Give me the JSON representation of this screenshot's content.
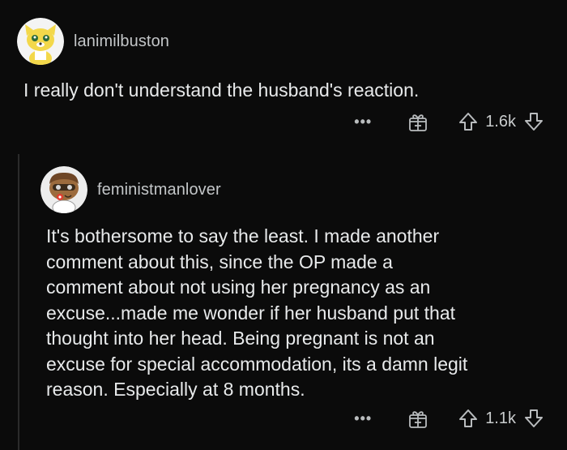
{
  "comments": [
    {
      "username": "lanimilbuston",
      "avatar_icon": "snoo-avatar-icon",
      "body": "I really don't understand the husband's reaction.",
      "more_label": "•••",
      "score": "1.6k"
    },
    {
      "username": "feministmanlover",
      "avatar_icon": "snoo-avatar-icon",
      "body": "It's bothersome to say the least.  I made another\ncomment about this, since the OP made a\ncomment about not using her pregnancy as an\nexcuse...made me wonder if her husband put that\nthought into her head.   Being pregnant is not an\nexcuse for special accommodation, its a damn legit\nreason.  Especially at 8 months.",
      "more_label": "•••",
      "score": "1.1k"
    }
  ],
  "colors": {
    "background": "#0b0b0b",
    "text": "#e8eaeb",
    "muted": "#b9bcbe"
  }
}
